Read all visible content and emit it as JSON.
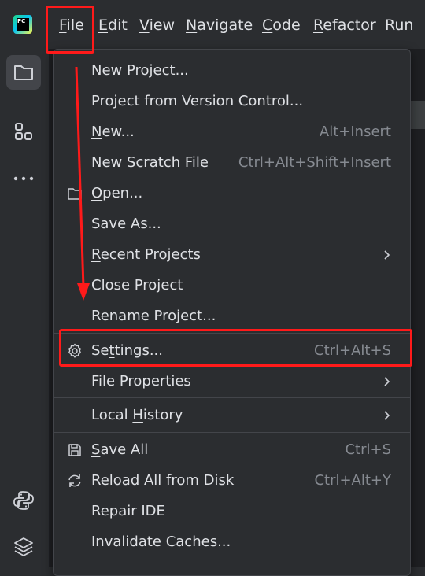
{
  "app": {
    "logo_text": "PC",
    "accent_color": "#ff1a1a"
  },
  "menubar": {
    "items": [
      {
        "label": "File",
        "mnemonic": "F",
        "rest": "ile"
      },
      {
        "label": "Edit",
        "mnemonic": "E",
        "rest": "dit"
      },
      {
        "label": "View",
        "mnemonic": "V",
        "rest": "iew"
      },
      {
        "label": "Navigate",
        "mnemonic": "N",
        "rest": "avigate"
      },
      {
        "label": "Code",
        "mnemonic": "C",
        "rest": "ode"
      },
      {
        "label": "Refactor",
        "mnemonic": "R",
        "rest": "efactor"
      },
      {
        "label": "Run",
        "mnemonic": "",
        "rest": "Run"
      }
    ]
  },
  "sidebar": {
    "icons": [
      "folder-icon",
      "structure-icon",
      "more-icon",
      "python-icon",
      "layers-icon"
    ]
  },
  "file_menu": {
    "items": [
      {
        "pre": "",
        "mn": "",
        "post": "New Project...",
        "shortcut": "",
        "icon": "",
        "submenu": false
      },
      {
        "pre": "",
        "mn": "",
        "post": "Project from Version Control...",
        "shortcut": "",
        "icon": "",
        "submenu": false
      },
      {
        "pre": "",
        "mn": "N",
        "post": "ew...",
        "shortcut": "Alt+Insert",
        "icon": "",
        "submenu": false
      },
      {
        "pre": "",
        "mn": "",
        "post": "New Scratch File",
        "shortcut": "Ctrl+Alt+Shift+Insert",
        "icon": "",
        "submenu": false
      },
      {
        "pre": "",
        "mn": "O",
        "post": "pen...",
        "shortcut": "",
        "icon": "folder-icon",
        "submenu": false
      },
      {
        "pre": "",
        "mn": "",
        "post": "Save As...",
        "shortcut": "",
        "icon": "",
        "submenu": false
      },
      {
        "pre": "",
        "mn": "R",
        "post": "ecent Projects",
        "shortcut": "",
        "icon": "",
        "submenu": true
      },
      {
        "pre": "",
        "mn": "",
        "post": "Close Project",
        "shortcut": "",
        "icon": "",
        "submenu": false
      },
      {
        "pre": "",
        "mn": "",
        "post": "Rename Project...",
        "shortcut": "",
        "icon": "",
        "submenu": false
      },
      {
        "pre": "Se",
        "mn": "t",
        "post": "tings...",
        "shortcut": "Ctrl+Alt+S",
        "icon": "gear-icon",
        "submenu": false
      },
      {
        "pre": "",
        "mn": "",
        "post": "File Properties",
        "shortcut": "",
        "icon": "",
        "submenu": true
      },
      {
        "pre": "Local ",
        "mn": "H",
        "post": "istory",
        "shortcut": "",
        "icon": "",
        "submenu": true
      },
      {
        "pre": "",
        "mn": "S",
        "post": "ave All",
        "shortcut": "Ctrl+S",
        "icon": "save-icon",
        "submenu": false
      },
      {
        "pre": "",
        "mn": "",
        "post": "Reload All from Disk",
        "shortcut": "Ctrl+Alt+Y",
        "icon": "reload-icon",
        "submenu": false
      },
      {
        "pre": "",
        "mn": "",
        "post": "Repair IDE",
        "shortcut": "",
        "icon": "",
        "submenu": false
      },
      {
        "pre": "",
        "mn": "",
        "post": "Invalidate Caches...",
        "shortcut": "",
        "icon": "",
        "submenu": false
      }
    ]
  }
}
